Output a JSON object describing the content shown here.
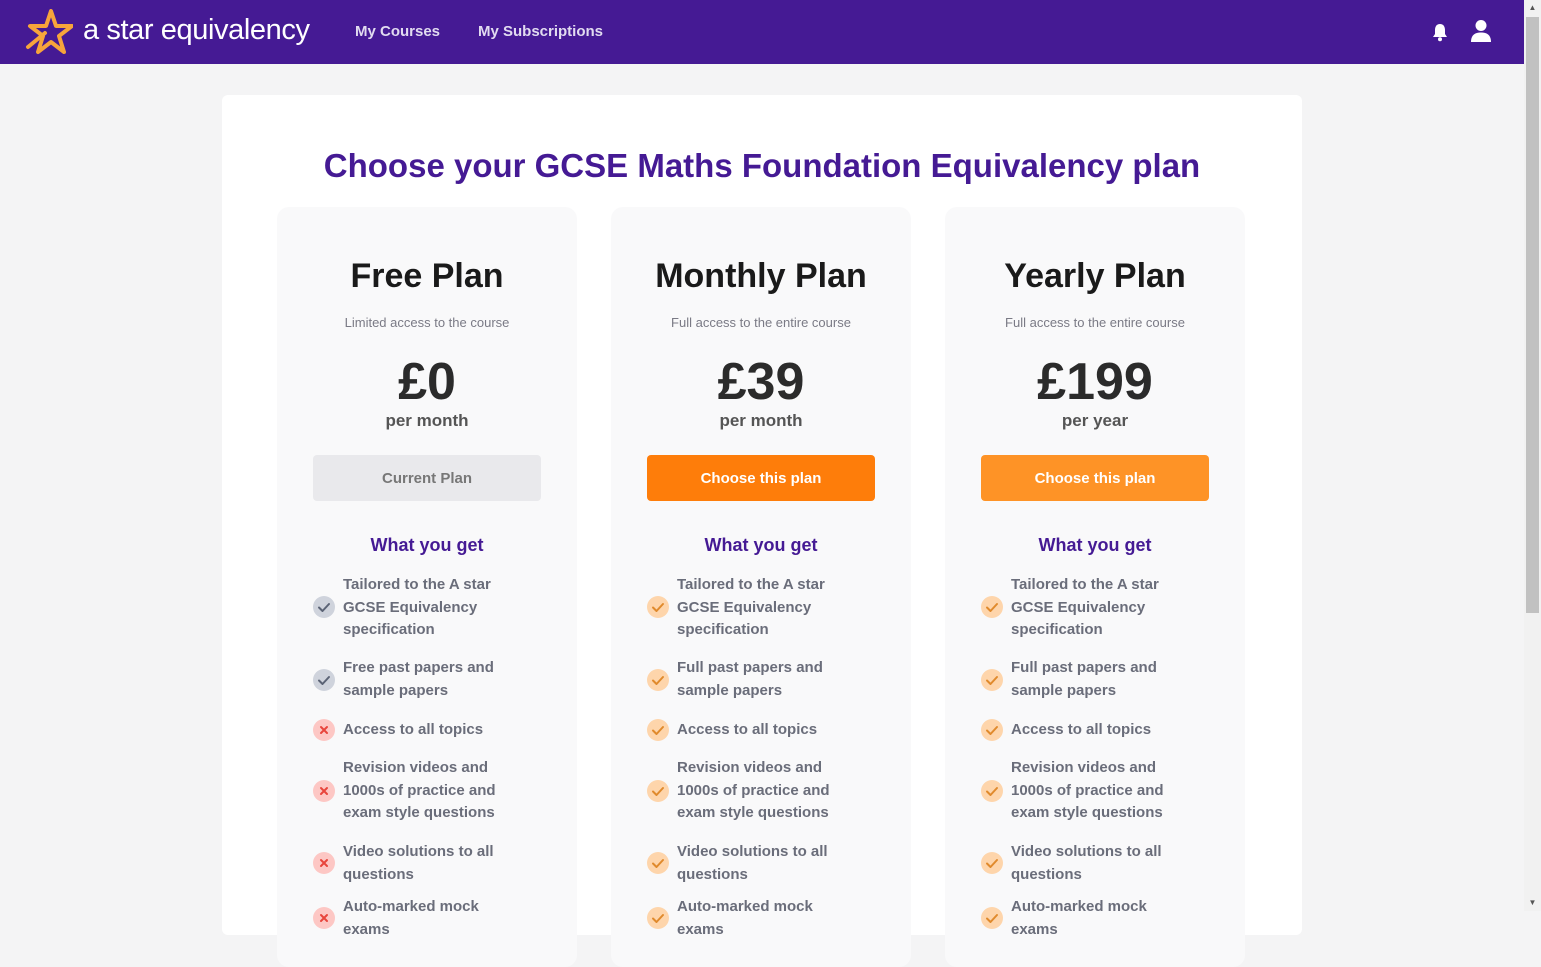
{
  "header": {
    "brand": "a star equivalency",
    "nav": [
      "My Courses",
      "My Subscriptions"
    ],
    "icons": [
      "bell-icon",
      "user-icon"
    ],
    "colors": {
      "bar": "#451a94"
    }
  },
  "page": {
    "title": "Choose your GCSE Maths Foundation Equivalency plan",
    "features_heading": "What you get"
  },
  "plans": [
    {
      "name": "Free Plan",
      "description": "Limited access to the course",
      "price": "£0",
      "period": "per month",
      "button": "Current Plan",
      "features": [
        {
          "text": "Tailored to the A star GCSE Equivalency specification",
          "status": "included"
        },
        {
          "text": "Free past papers and sample papers",
          "status": "included"
        },
        {
          "text": "Access to all topics",
          "status": "excluded"
        },
        {
          "text": "Revision videos and 1000s of practice and exam style questions",
          "status": "excluded"
        },
        {
          "text": "Video solutions to all questions",
          "status": "excluded"
        },
        {
          "text": "Auto-marked mock exams",
          "status": "excluded"
        }
      ]
    },
    {
      "name": "Monthly Plan",
      "description": "Full access to the entire course",
      "price": "£39",
      "period": "per month",
      "button": "Choose this plan",
      "features": [
        {
          "text": "Tailored to the A star GCSE Equivalency specification",
          "status": "included"
        },
        {
          "text": "Full past papers and sample papers",
          "status": "included"
        },
        {
          "text": "Access to all topics",
          "status": "included"
        },
        {
          "text": "Revision videos and 1000s of practice and exam style questions",
          "status": "included"
        },
        {
          "text": "Video solutions to all questions",
          "status": "included"
        },
        {
          "text": "Auto-marked mock exams",
          "status": "included"
        }
      ]
    },
    {
      "name": "Yearly Plan",
      "description": "Full access to the entire course",
      "price": "£199",
      "period": "per year",
      "button": "Choose this plan",
      "features": [
        {
          "text": "Tailored to the A star GCSE Equivalency specification",
          "status": "included"
        },
        {
          "text": "Full past papers and sample papers",
          "status": "included"
        },
        {
          "text": "Access to all topics",
          "status": "included"
        },
        {
          "text": "Revision videos and 1000s of practice and exam style questions",
          "status": "included"
        },
        {
          "text": "Video solutions to all questions",
          "status": "included"
        },
        {
          "text": "Auto-marked mock exams",
          "status": "included"
        }
      ]
    }
  ],
  "colors": {
    "accent": "#451a94",
    "orange_button": "#fe7d0a",
    "check_free": "#cfd3dc",
    "cross": "#fdc7c4",
    "check_paid": "#fed5ab"
  }
}
